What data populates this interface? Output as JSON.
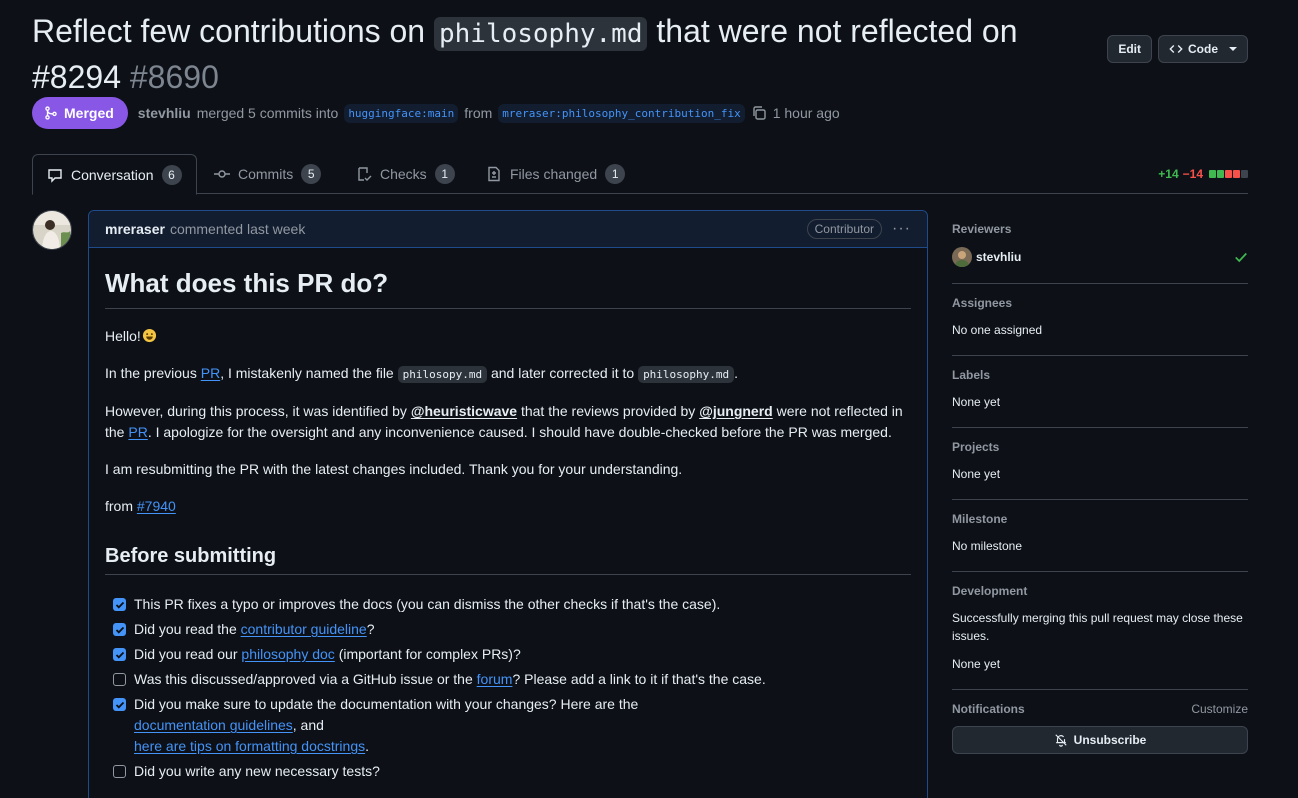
{
  "header": {
    "title_before": "Reflect few contributions on ",
    "title_code": "philosophy.md",
    "title_after": " that were not reflected on #8294",
    "number": "#8690",
    "edit_label": "Edit",
    "code_label": "Code"
  },
  "meta": {
    "status": "Merged",
    "author": "stevhliu",
    "action": "merged 5 commits into",
    "base_branch": "huggingface:main",
    "from_label": "from",
    "head_branch": "mreraser:philosophy_contribution_fix",
    "time": "1 hour ago"
  },
  "tabs": [
    {
      "label": "Conversation",
      "count": "6"
    },
    {
      "label": "Commits",
      "count": "5"
    },
    {
      "label": "Checks",
      "count": "1"
    },
    {
      "label": "Files changed",
      "count": "1"
    }
  ],
  "diffstat": {
    "additions": "+14",
    "deletions": "−14"
  },
  "colors": {
    "accent": "#4493f8",
    "merged": "#8957e5",
    "add": "#3fb950",
    "del": "#f85149"
  },
  "comment": {
    "author": "mreraser",
    "action": "commented last week",
    "role": "Contributor",
    "h1": "What does this PR do?",
    "hello": "Hello!",
    "p1_a": "In the previous ",
    "p1_link": "PR",
    "p1_b": ", I mistakenly named the file ",
    "p1_code1": "philosopy.md",
    "p1_c": " and later corrected it to ",
    "p1_code2": "philosophy.md",
    "p1_d": ".",
    "p2_a": "However, during this process, it was identified by ",
    "p2_m1": "@heuristicwave",
    "p2_b": " that the reviews provided by ",
    "p2_m2": "@jungnerd",
    "p2_c": " were not reflected in the ",
    "p2_link": "PR",
    "p2_d": ". I apologize for the oversight and any inconvenience caused. I should have double-checked before the PR was merged.",
    "p3": "I am resubmitting the PR with the latest changes included. Thank you for your understanding.",
    "p4_a": "from ",
    "p4_link": "#7940",
    "h2": "Before submitting",
    "tasks": [
      {
        "checked": true,
        "a": "This PR fixes a typo or improves the docs (you can dismiss the other checks if that's the case)."
      },
      {
        "checked": true,
        "a": "Did you read the ",
        "link": "contributor guideline",
        "b": "?"
      },
      {
        "checked": true,
        "a": "Did you read our ",
        "link": "philosophy doc",
        "b": " (important for complex PRs)?"
      },
      {
        "checked": false,
        "a": "Was this discussed/approved via a GitHub issue or the ",
        "link": "forum",
        "b": "? Please add a link to it if that's the case."
      },
      {
        "checked": true,
        "a": "Did you make sure to update the documentation with your changes? Here are the",
        "link": "documentation guidelines",
        "b": ", and",
        "link2": "here are tips on formatting docstrings",
        "c": "."
      },
      {
        "checked": false,
        "a": "Did you write any new necessary tests?"
      }
    ]
  },
  "sidebar": {
    "reviewers_title": "Reviewers",
    "reviewer": "stevhliu",
    "assignees_title": "Assignees",
    "assignees_value": "No one assigned",
    "labels_title": "Labels",
    "labels_value": "None yet",
    "projects_title": "Projects",
    "projects_value": "None yet",
    "milestone_title": "Milestone",
    "milestone_value": "No milestone",
    "development_title": "Development",
    "development_text": "Successfully merging this pull request may close these issues.",
    "development_value": "None yet",
    "notifications_title": "Notifications",
    "customize_label": "Customize",
    "unsubscribe_label": "Unsubscribe"
  }
}
